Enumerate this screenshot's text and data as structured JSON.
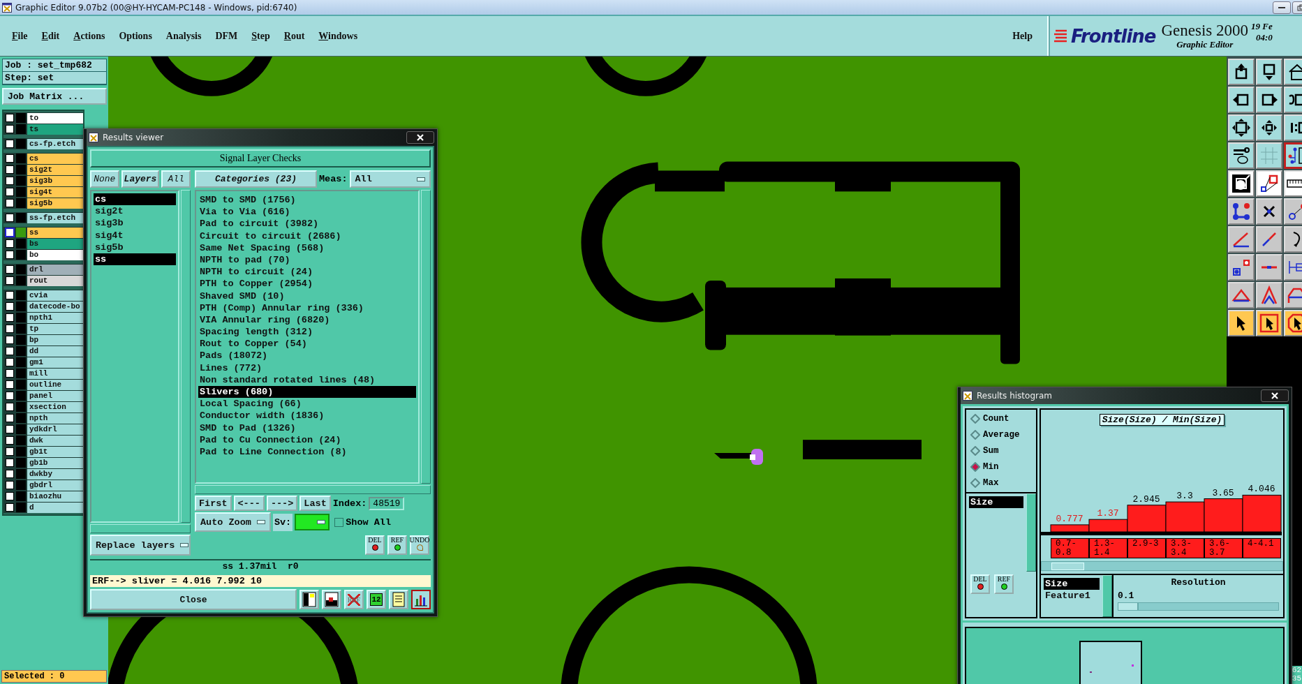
{
  "window": {
    "title": "Graphic Editor 9.07b2 (00@HY-HYCAM-PC148 - Windows, pid:6740)"
  },
  "menu": [
    {
      "label": "File",
      "underline": true
    },
    {
      "label": "Edit",
      "underline": true
    },
    {
      "label": "Actions",
      "underline": true
    },
    {
      "label": "Options",
      "underline": false
    },
    {
      "label": "Analysis",
      "underline": false
    },
    {
      "label": "DFM",
      "underline": false
    },
    {
      "label": "Step",
      "underline": true
    },
    {
      "label": "Rout",
      "underline": true
    },
    {
      "label": "Windows",
      "underline": true
    }
  ],
  "help": "Help",
  "brand": {
    "logo": "Frontline",
    "product": "Genesis 2000",
    "subtitle": "Graphic Editor",
    "date": "19 Fe",
    "time": "04:0"
  },
  "job": {
    "job": "Job : set_tmp682",
    "step": "Step: set",
    "matrix_button": "Job Matrix ..."
  },
  "layer_groups": [
    {
      "layers": [
        {
          "name": "to",
          "color": "#ffffff",
          "active": false,
          "checked": false
        },
        {
          "name": "ts",
          "color": "#1fa580",
          "active": false,
          "checked": false
        }
      ]
    },
    {
      "layers": [
        {
          "name": "cs-fp.etch",
          "color": "#a4dcdc",
          "active": false,
          "checked": false
        }
      ]
    },
    {
      "layers": [
        {
          "name": "cs",
          "color": "#ffc850",
          "active": false,
          "checked": false
        },
        {
          "name": "sig2t",
          "color": "#ffc850",
          "active": false,
          "checked": false
        },
        {
          "name": "sig3b",
          "color": "#ffc850",
          "active": false,
          "checked": false
        },
        {
          "name": "sig4t",
          "color": "#ffc850",
          "active": false,
          "checked": false
        },
        {
          "name": "sig5b",
          "color": "#ffc850",
          "active": false,
          "checked": false
        }
      ]
    },
    {
      "layers": [
        {
          "name": "ss-fp.etch",
          "color": "#a4dcdc",
          "active": false,
          "checked": false
        }
      ]
    },
    {
      "layers": [
        {
          "name": "ss",
          "color": "#ffc850",
          "active": true,
          "checked": false
        },
        {
          "name": "bs",
          "color": "#1fa580",
          "active": false,
          "checked": false
        },
        {
          "name": "bo",
          "color": "#ffffff",
          "active": false,
          "checked": false
        }
      ]
    },
    {
      "layers": [
        {
          "name": "drl",
          "color": "#a0b0b8",
          "active": false,
          "checked": false
        },
        {
          "name": "rout",
          "color": "#d8d8d8",
          "active": false,
          "checked": false
        }
      ]
    },
    {
      "layers": [
        {
          "name": "cvia",
          "color": "#a4dcdc",
          "active": false,
          "checked": false
        },
        {
          "name": "datecode-bo",
          "color": "#a4dcdc",
          "active": false,
          "checked": false
        },
        {
          "name": "npth1",
          "color": "#a4dcdc",
          "active": false,
          "checked": false
        },
        {
          "name": "tp",
          "color": "#a4dcdc",
          "active": false,
          "checked": false
        },
        {
          "name": "bp",
          "color": "#a4dcdc",
          "active": false,
          "checked": false
        },
        {
          "name": "dd",
          "color": "#a4dcdc",
          "active": false,
          "checked": false
        },
        {
          "name": "gm1",
          "color": "#a4dcdc",
          "active": false,
          "checked": false
        },
        {
          "name": "mill",
          "color": "#a4dcdc",
          "active": false,
          "checked": false
        },
        {
          "name": "outline",
          "color": "#a4dcdc",
          "active": false,
          "checked": false
        },
        {
          "name": "panel",
          "color": "#a4dcdc",
          "active": false,
          "checked": false
        },
        {
          "name": "xsection",
          "color": "#a4dcdc",
          "active": false,
          "checked": false
        },
        {
          "name": "npth",
          "color": "#a4dcdc",
          "active": false,
          "checked": false
        },
        {
          "name": "ydkdrl",
          "color": "#a4dcdc",
          "active": false,
          "checked": false
        },
        {
          "name": "dwk",
          "color": "#a4dcdc",
          "active": false,
          "checked": false
        },
        {
          "name": "gb1t",
          "color": "#a4dcdc",
          "active": false,
          "checked": false
        },
        {
          "name": "gb1b",
          "color": "#a4dcdc",
          "active": false,
          "checked": false
        },
        {
          "name": "dwkby",
          "color": "#a4dcdc",
          "active": false,
          "checked": false
        },
        {
          "name": "gbdrl",
          "color": "#a4dcdc",
          "active": false,
          "checked": false
        },
        {
          "name": "biaozhu",
          "color": "#a4dcdc",
          "active": false,
          "checked": false
        },
        {
          "name": "d",
          "color": "#a4dcdc",
          "active": false,
          "checked": false
        }
      ]
    }
  ],
  "selected_status": "Selected : 0",
  "side_readout": [
    "62",
    "35"
  ],
  "results_viewer": {
    "title": "Results viewer",
    "header": "Signal Layer Checks",
    "layer_buttons": [
      "None",
      "Layers",
      "All"
    ],
    "layers": [
      {
        "name": "cs",
        "selected": true
      },
      {
        "name": "sig2t",
        "selected": false
      },
      {
        "name": "sig3b",
        "selected": false
      },
      {
        "name": "sig4t",
        "selected": false
      },
      {
        "name": "sig5b",
        "selected": false
      },
      {
        "name": "ss",
        "selected": true
      }
    ],
    "categories_button": "Categories (23)",
    "meas_label": "Meas:",
    "meas_value": "All",
    "categories": [
      {
        "label": "SMD to SMD (1756)",
        "selected": false
      },
      {
        "label": "Via to Via (616)",
        "selected": false
      },
      {
        "label": "Pad to circuit (3982)",
        "selected": false
      },
      {
        "label": "Circuit to circuit (2686)",
        "selected": false
      },
      {
        "label": "Same Net Spacing (568)",
        "selected": false
      },
      {
        "label": "NPTH to pad (70)",
        "selected": false
      },
      {
        "label": "NPTH to circuit (24)",
        "selected": false
      },
      {
        "label": "PTH to Copper (2954)",
        "selected": false
      },
      {
        "label": "Shaved SMD (10)",
        "selected": false
      },
      {
        "label": "PTH (Comp) Annular ring (336)",
        "selected": false
      },
      {
        "label": "VIA Annular ring (6820)",
        "selected": false
      },
      {
        "label": "Spacing length (312)",
        "selected": false
      },
      {
        "label": "Rout to Copper (54)",
        "selected": false
      },
      {
        "label": "Pads (18072)",
        "selected": false
      },
      {
        "label": "Lines (772)",
        "selected": false
      },
      {
        "label": "Non standard rotated lines (48)",
        "selected": false
      },
      {
        "label": "Slivers (680)",
        "selected": true
      },
      {
        "label": "Local Spacing (66)",
        "selected": false
      },
      {
        "label": "Conductor width (1836)",
        "selected": false
      },
      {
        "label": "SMD to Pad (1326)",
        "selected": false
      },
      {
        "label": "Pad to Cu Connection (24)",
        "selected": false
      },
      {
        "label": "Pad to Line Connection (8)",
        "selected": false
      }
    ],
    "nav_buttons": [
      "First",
      "<---",
      "--->",
      "Last"
    ],
    "index_label": "Index:",
    "index_value": "48519",
    "zoom_mode": "Auto Zoom",
    "sv_label": "Sv:",
    "show_all": {
      "label": "Show All",
      "checked": false
    },
    "replace_mode": "Replace layers",
    "action_buttons": [
      "DEL",
      "REF",
      "UNDO"
    ],
    "status": "ss 1.37mil  r0",
    "erf": "ERF--> sliver = 4.016 7.992 10",
    "close": "Close",
    "tools": [
      {
        "kind": "legend"
      },
      {
        "kind": "layer"
      },
      {
        "kind": "ref-off",
        "label": "REF"
      },
      {
        "kind": "number",
        "label": "12"
      },
      {
        "kind": "notes"
      },
      {
        "kind": "histogram"
      }
    ]
  },
  "histogram": {
    "title": "Results histogram",
    "modes": [
      {
        "label": "Count",
        "selected": false
      },
      {
        "label": "Average",
        "selected": false
      },
      {
        "label": "Sum",
        "selected": false
      },
      {
        "label": "Min",
        "selected": true
      },
      {
        "label": "Max",
        "selected": false
      }
    ],
    "attributes": [
      {
        "name": "Size",
        "selected": true
      }
    ],
    "buttons": [
      "DEL",
      "REF"
    ],
    "chart_data": {
      "type": "bar",
      "title": "Size(Size) / Min(Size)",
      "categories": [
        "0.7-0.8",
        "1.3-1.4",
        "2.9-3",
        "3.3-3.4",
        "3.6-3.7",
        "4-4.1"
      ],
      "series": [
        {
          "color": "#ff1c1c",
          "values": [
            0.777,
            1.37,
            2.945,
            3.3,
            3.65,
            4.046
          ]
        }
      ],
      "data_labels": true
    },
    "bar_labels": [
      {
        "color": "#e02020"
      },
      {
        "color": "#e02020"
      },
      {
        "color": "#000000"
      },
      {
        "color": "#000000"
      },
      {
        "color": "#000000"
      },
      {
        "color": "#000000"
      }
    ],
    "fields": [
      {
        "name": "Size",
        "selected": true
      },
      {
        "name": "Feature1",
        "selected": false
      }
    ],
    "resolution_label": "Resolution",
    "resolution_value": "0.1",
    "resolution": {
      "level": 0.12
    }
  }
}
